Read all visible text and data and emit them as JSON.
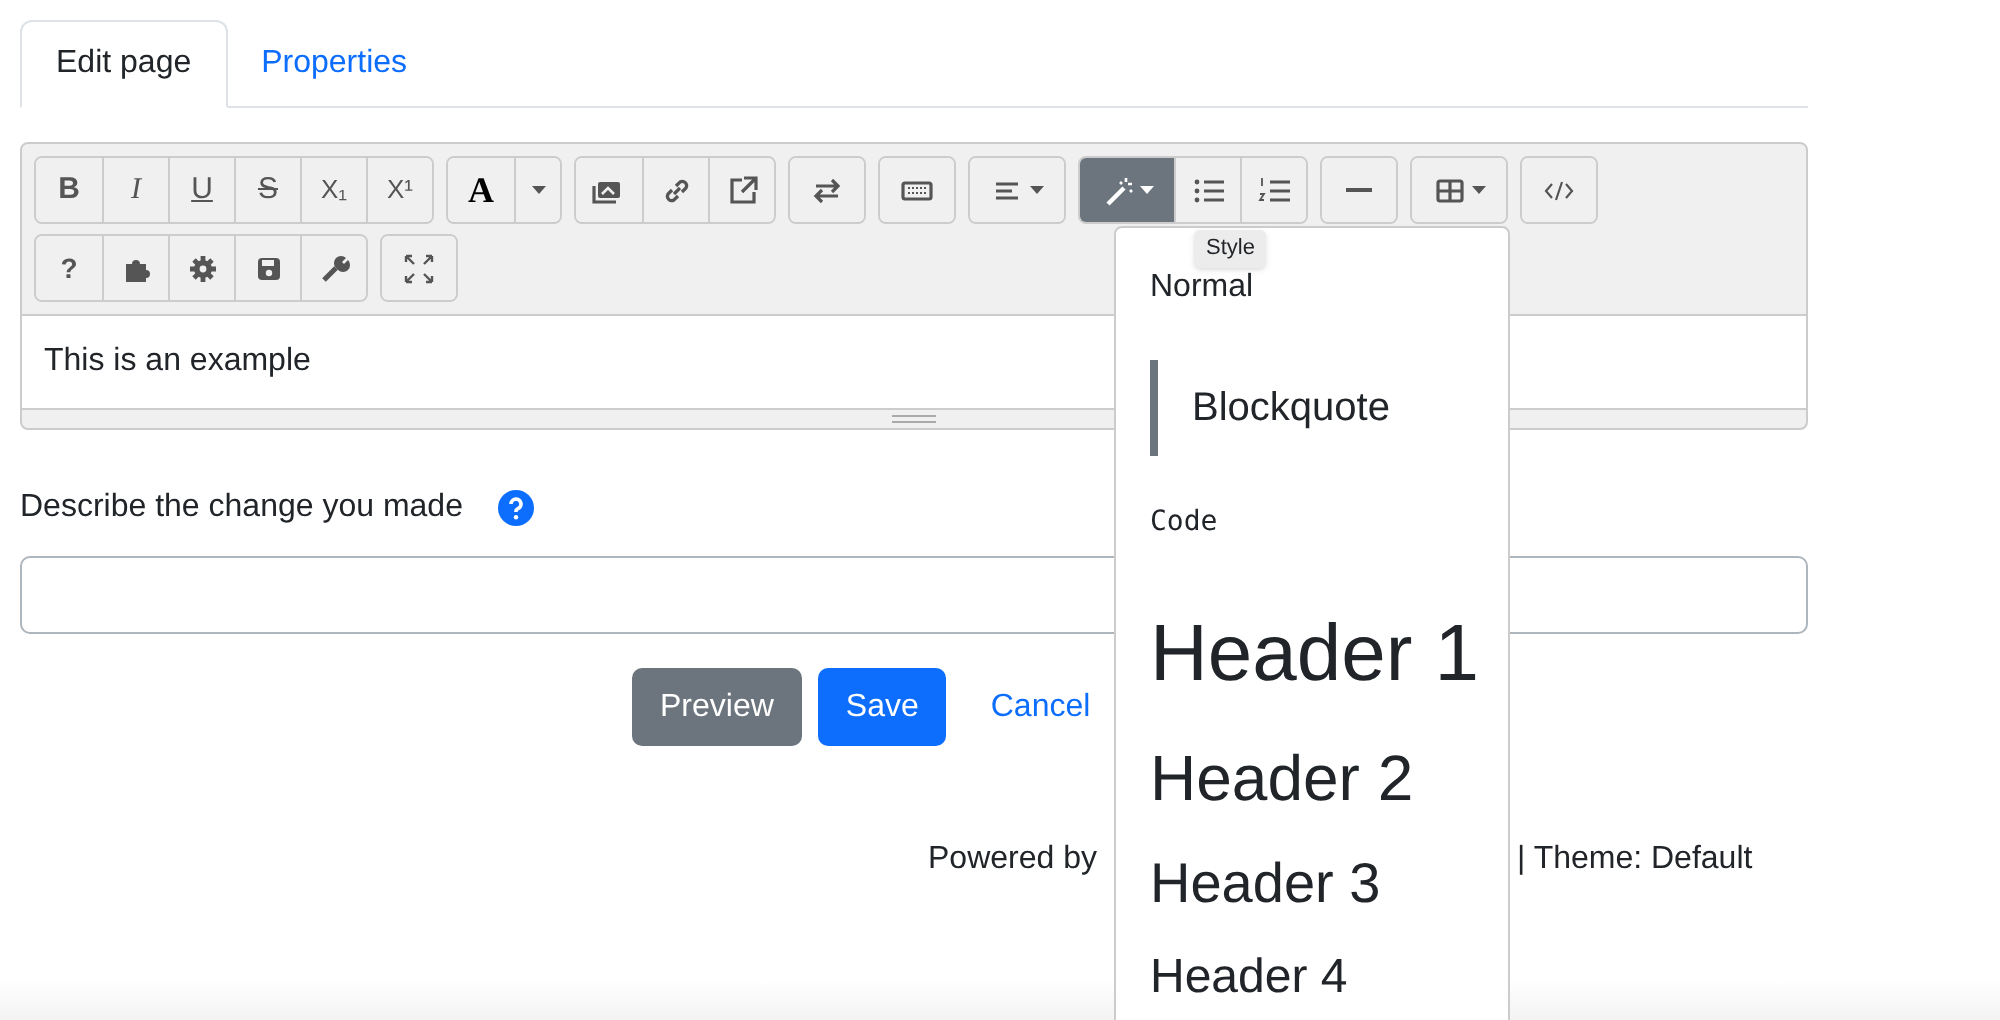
{
  "tabs": [
    {
      "label": "Edit page",
      "selected": true
    },
    {
      "label": "Properties",
      "selected": false
    }
  ],
  "toolbar": {
    "rows": [
      [
        [
          {
            "kind": "bold",
            "label": "B"
          },
          {
            "kind": "italic",
            "label": "I"
          },
          {
            "kind": "underline",
            "label": "U"
          },
          {
            "kind": "strike",
            "label": "S"
          },
          {
            "kind": "subscript",
            "label": "X₁"
          },
          {
            "kind": "superscript",
            "label": "X¹"
          }
        ],
        [
          {
            "kind": "font-color",
            "label": "A"
          },
          {
            "kind": "caret"
          }
        ],
        [
          {
            "kind": "image"
          },
          {
            "kind": "link"
          },
          {
            "kind": "external"
          }
        ],
        [
          {
            "kind": "swap"
          }
        ],
        [
          {
            "kind": "keyboard"
          }
        ],
        [
          {
            "kind": "align",
            "dropdown": true
          }
        ],
        [
          {
            "kind": "magic",
            "dropdown": true,
            "selected": true
          },
          {
            "kind": "bullets",
            "selected": false
          },
          {
            "kind": "numbers",
            "selected": false
          }
        ],
        [
          {
            "kind": "rule"
          }
        ],
        [
          {
            "kind": "table",
            "dropdown": true
          }
        ],
        [
          {
            "kind": "code"
          }
        ]
      ],
      [
        [
          {
            "kind": "help",
            "label": "?"
          },
          {
            "kind": "puzzle"
          },
          {
            "kind": "gear"
          },
          {
            "kind": "save"
          },
          {
            "kind": "wrench"
          }
        ],
        [
          {
            "kind": "fullscreen"
          }
        ]
      ]
    ]
  },
  "editor": {
    "content": "This is an example"
  },
  "summary": {
    "label": "Describe the change you made"
  },
  "buttons": [
    {
      "kind": "secondary",
      "label": "Preview"
    },
    {
      "kind": "primary",
      "label": "Save"
    },
    {
      "kind": "link",
      "label": "Cancel"
    }
  ],
  "footer": {
    "left": "Powered by",
    "right": "| Theme: Default"
  },
  "tooltip": "Style",
  "style_menu": [
    {
      "kind": "normal",
      "label": "Normal"
    },
    {
      "kind": "blockquote",
      "label": "Blockquote"
    },
    {
      "kind": "code",
      "label": "Code"
    },
    {
      "kind": "h1",
      "label": "Header 1"
    },
    {
      "kind": "h2",
      "label": "Header 2"
    },
    {
      "kind": "h3",
      "label": "Header 3"
    },
    {
      "kind": "h4",
      "label": "Header 4"
    }
  ]
}
